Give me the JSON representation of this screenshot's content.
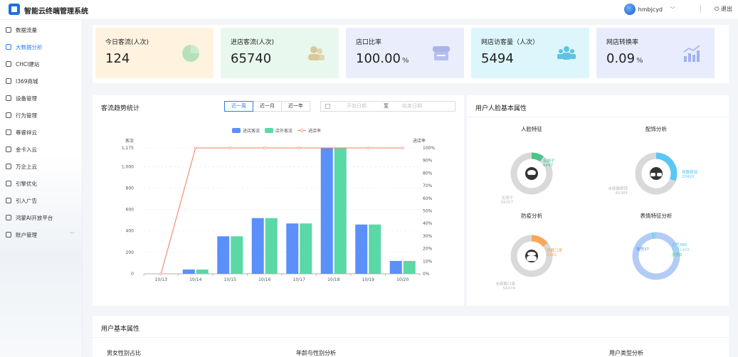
{
  "app": {
    "title": "智能云终端管理系统"
  },
  "header": {
    "username": "hmbjcyd",
    "logout": "退出"
  },
  "sidebar": {
    "items": [
      {
        "label": "数据流量"
      },
      {
        "label": "大数据分析",
        "active": true
      },
      {
        "label": "CHCI建站"
      },
      {
        "label": "I369商城"
      },
      {
        "label": "设备管理"
      },
      {
        "label": "行为管理"
      },
      {
        "label": "尊睿祥云"
      },
      {
        "label": "金卡入云"
      },
      {
        "label": "万企上云"
      },
      {
        "label": "引擎优化"
      },
      {
        "label": "引入广告"
      },
      {
        "label": "鸿蒙AI开放平台"
      },
      {
        "label": "账户管理",
        "has_submenu": true
      }
    ]
  },
  "stats": [
    {
      "label": "今日客流(人次)",
      "value": "124",
      "unit": "",
      "icon": "pie-chart-icon",
      "bg": "#fff3e0",
      "accent": "#9ad7a7"
    },
    {
      "label": "进店客流(人次)",
      "value": "65740",
      "unit": "",
      "icon": "people-icon",
      "bg": "#e9f8ef",
      "accent": "#d9c89a"
    },
    {
      "label": "店口比率",
      "value": "100.00",
      "unit": "%",
      "icon": "store-icon",
      "bg": "#e9edfc",
      "accent": "#a8b4ea"
    },
    {
      "label": "网店访客量（人次）",
      "value": "5494",
      "unit": "",
      "icon": "group-icon",
      "bg": "#dcf6fb",
      "accent": "#5cc4e2"
    },
    {
      "label": "网店转换率",
      "value": "0.09",
      "unit": "%",
      "icon": "growth-chart-icon",
      "bg": "#e8ecfc",
      "accent": "#9fb2ef"
    }
  ],
  "traffic": {
    "title": "客流趋势统计",
    "tabs": [
      "近一周",
      "近一月",
      "近一年"
    ],
    "active_tab": 0,
    "date_start_placeholder": "开始日期",
    "date_to": "至",
    "date_end_placeholder": "结束日期"
  },
  "chart_data": {
    "type": "bar",
    "categories": [
      "10/13",
      "10/14",
      "10/15",
      "10/16",
      "10/17",
      "10/18",
      "10/19",
      "10/20"
    ],
    "series": [
      {
        "name": "进店客流",
        "type": "bar",
        "color": "#5b8ff9",
        "values": [
          0,
          40,
          350,
          520,
          470,
          1175,
          460,
          120
        ]
      },
      {
        "name": "店外客流",
        "type": "bar",
        "color": "#5ad8a6",
        "values": [
          0,
          40,
          350,
          520,
          470,
          1175,
          460,
          120
        ]
      },
      {
        "name": "进店率",
        "type": "line",
        "axis": "right",
        "color": "#ee7c5e",
        "values": [
          0,
          100,
          100,
          100,
          100,
          100,
          100,
          100
        ]
      }
    ],
    "ylabel_left": "客流",
    "ylabel_right": "进店率",
    "yticks_left": [
      0,
      200,
      400,
      600,
      800,
      "1,000",
      "1,175"
    ],
    "ylim_left": [
      0,
      1175
    ],
    "yticks_right": [
      "0%",
      "10%",
      "20%",
      "30%",
      "40%",
      "50%",
      "60%",
      "70%",
      "80%",
      "90%",
      "100%"
    ],
    "ylim_right": [
      0,
      100
    ],
    "legend": "top-center",
    "grid": true
  },
  "face": {
    "title": "用户人脸基本属性",
    "charts": [
      {
        "title": "人脸特征",
        "icon": "beard-face-icon",
        "slices": [
          {
            "label": "有胡子",
            "value": 6497,
            "color": "#4cc38a"
          },
          {
            "label": "无胡子",
            "value": 59307,
            "color": "#d9d9d9"
          }
        ]
      },
      {
        "title": "配饰分析",
        "icon": "glasses-icon",
        "slices": [
          {
            "label": "佩戴眼镜",
            "value": 20420,
            "color": "#5bc6f5"
          },
          {
            "label": "未佩戴眼镜",
            "value": 45384,
            "color": "#d9d9d9"
          }
        ]
      },
      {
        "title": "防疫分析",
        "icon": "mask-icon",
        "slices": [
          {
            "label": "佩戴口罩",
            "value": 9330,
            "color": "#f5a85b"
          },
          {
            "label": "未佩戴口罩",
            "value": 56474,
            "color": "#d9d9d9"
          }
        ]
      },
      {
        "title": "表情特征分析",
        "icon": "",
        "slices": [
          {
            "label": "平静",
            "value": 63839,
            "color": "#b3ccf5"
          },
          {
            "label": "愉悦",
            "value": 37,
            "color": "#5b8ff9"
          },
          {
            "label": "生气",
            "value": 365,
            "color": "#45c6d8"
          },
          {
            "label": "惊讶",
            "value": 1465,
            "color": "#8fd6e8"
          },
          {
            "label": "厌恶",
            "value": 0,
            "color": "#4cc38a"
          }
        ]
      }
    ]
  },
  "user_basic": {
    "title": "用户基本属性",
    "subtitles": [
      "男女性别占比",
      "年龄与性别分析",
      "用户类型分析"
    ]
  }
}
